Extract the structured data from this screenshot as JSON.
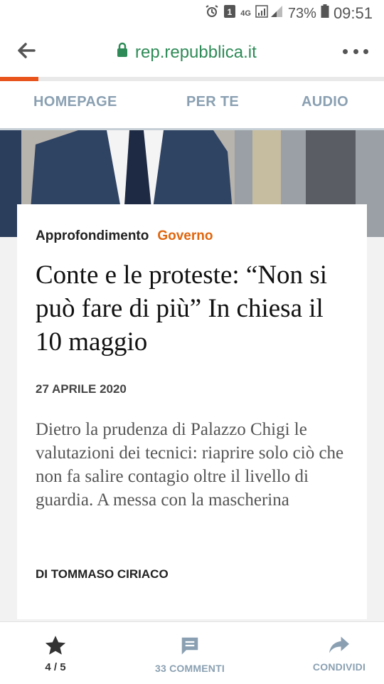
{
  "status_bar": {
    "network": "4G",
    "battery_percent": "73%",
    "time": "09:51",
    "icons": [
      "alarm-icon",
      "notification-icon",
      "signal-icon",
      "battery-icon"
    ]
  },
  "browser": {
    "url": "rep.repubblica.it",
    "icons": [
      "back-arrow-icon",
      "lock-icon",
      "more-dots-icon"
    ],
    "accent_color": "#2e8b57"
  },
  "reading_progress": 0.1,
  "tabs": [
    {
      "label": "HOMEPAGE"
    },
    {
      "label": "PER TE"
    },
    {
      "label": "AUDIO"
    }
  ],
  "article": {
    "section": "Approfondimento",
    "category": "Governo",
    "category_color": "#e0660f",
    "title": "Conte e le proteste: “Non si può fare di più” In chiesa il 10 maggio",
    "date": "27 APRILE 2020",
    "summary": "Dietro la prudenza di Palazzo Chigi le valutazioni dei tecnici: riaprire solo ciò che non fa salire contagio oltre il livello di guardia. A messa con la mascherina",
    "author": "DI TOMMASO CIRIACO"
  },
  "bottom_bar": {
    "pager": "4 / 5",
    "comments_label": "33 COMMENTI",
    "share_label": "CONDIVIDI",
    "icons": [
      "star-icon",
      "comment-icon",
      "share-icon"
    ]
  }
}
